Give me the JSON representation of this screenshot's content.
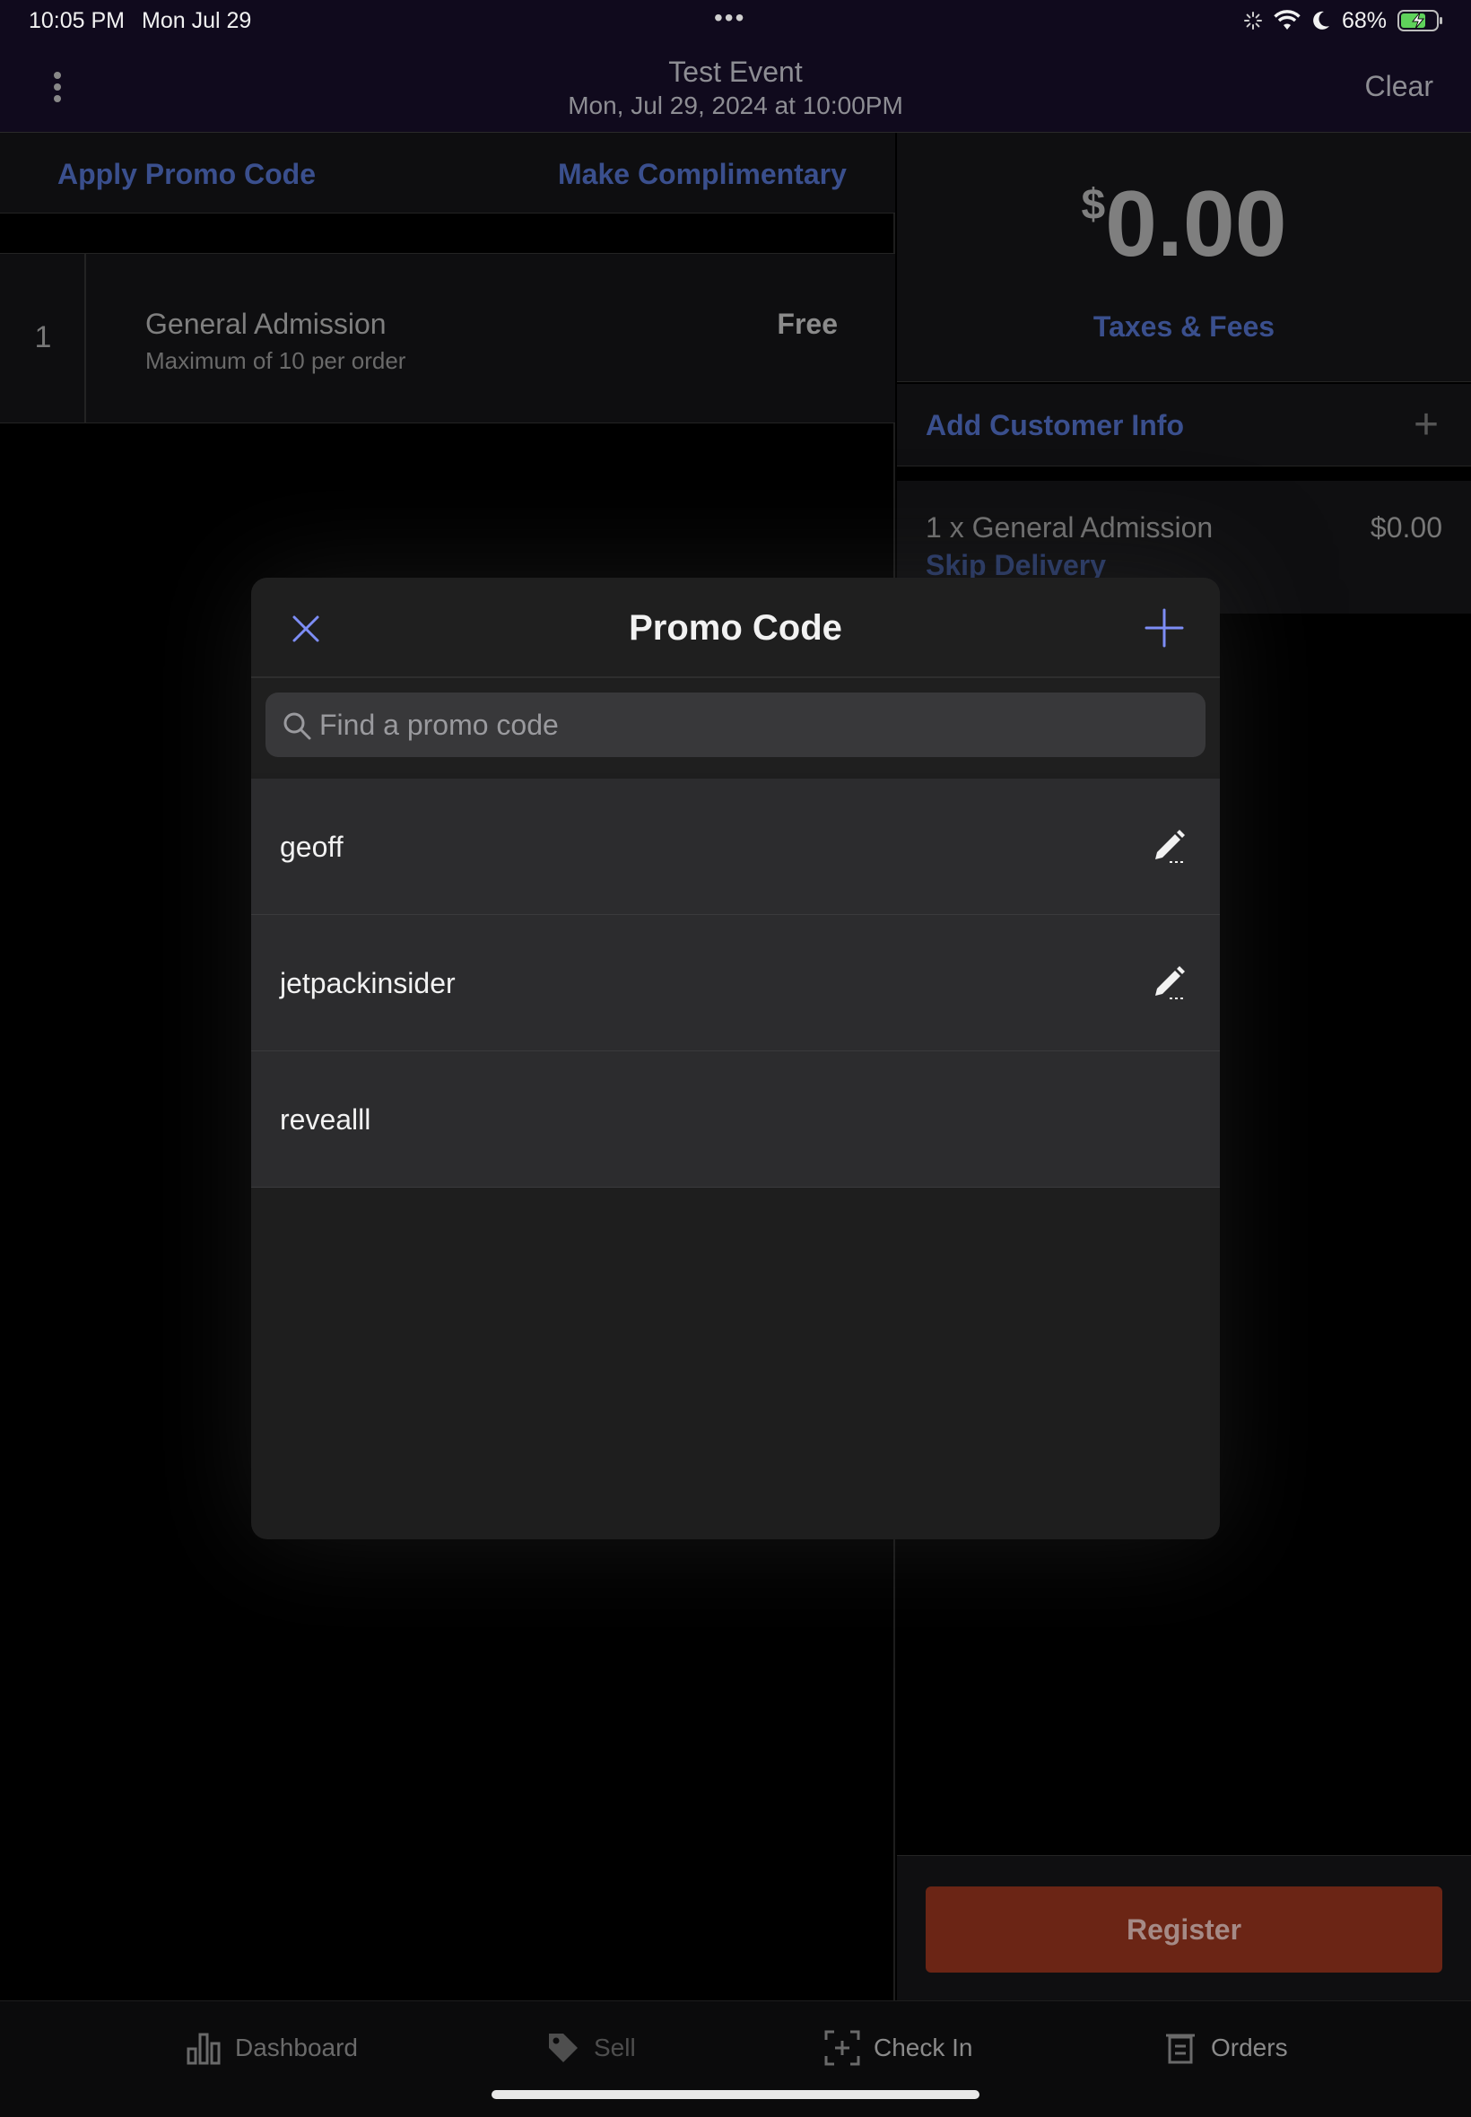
{
  "status_bar": {
    "time": "10:05 PM",
    "date": "Mon Jul 29",
    "dots": "•••",
    "battery": "68%"
  },
  "header": {
    "title": "Test Event",
    "subtitle": "Mon, Jul 29, 2024 at 10:00PM",
    "clear_label": "Clear"
  },
  "left": {
    "apply_promo_label": "Apply Promo Code",
    "make_comp_label": "Make Complimentary",
    "ticket": {
      "qty": "1",
      "name": "General Admission",
      "limit": "Maximum of 10 per order",
      "price": "Free"
    }
  },
  "right": {
    "currency": "$",
    "total": "0.00",
    "taxes_label": "Taxes & Fees",
    "customer_label": "Add Customer Info",
    "order_line": "1 x General Admission",
    "order_amount": "$0.00",
    "skip_label": "Skip Delivery",
    "register_label": "Register"
  },
  "modal": {
    "title": "Promo Code",
    "search_placeholder": "Find a promo code",
    "codes": [
      {
        "code": "geoff",
        "editable": true
      },
      {
        "code": "jetpackinsider",
        "editable": true
      },
      {
        "code": "revealll",
        "editable": false
      }
    ]
  },
  "tabs": [
    {
      "label": "Dashboard",
      "icon": "bar-chart-icon"
    },
    {
      "label": "Sell",
      "icon": "tag-icon"
    },
    {
      "label": "Check In",
      "icon": "scan-icon"
    },
    {
      "label": "Orders",
      "icon": "receipt-icon"
    }
  ],
  "colors": {
    "accent_link": "#3a4f8d",
    "modal_accent": "#7d8df5",
    "register_bg": "#6b2515",
    "header_bg": "#100a1d"
  }
}
